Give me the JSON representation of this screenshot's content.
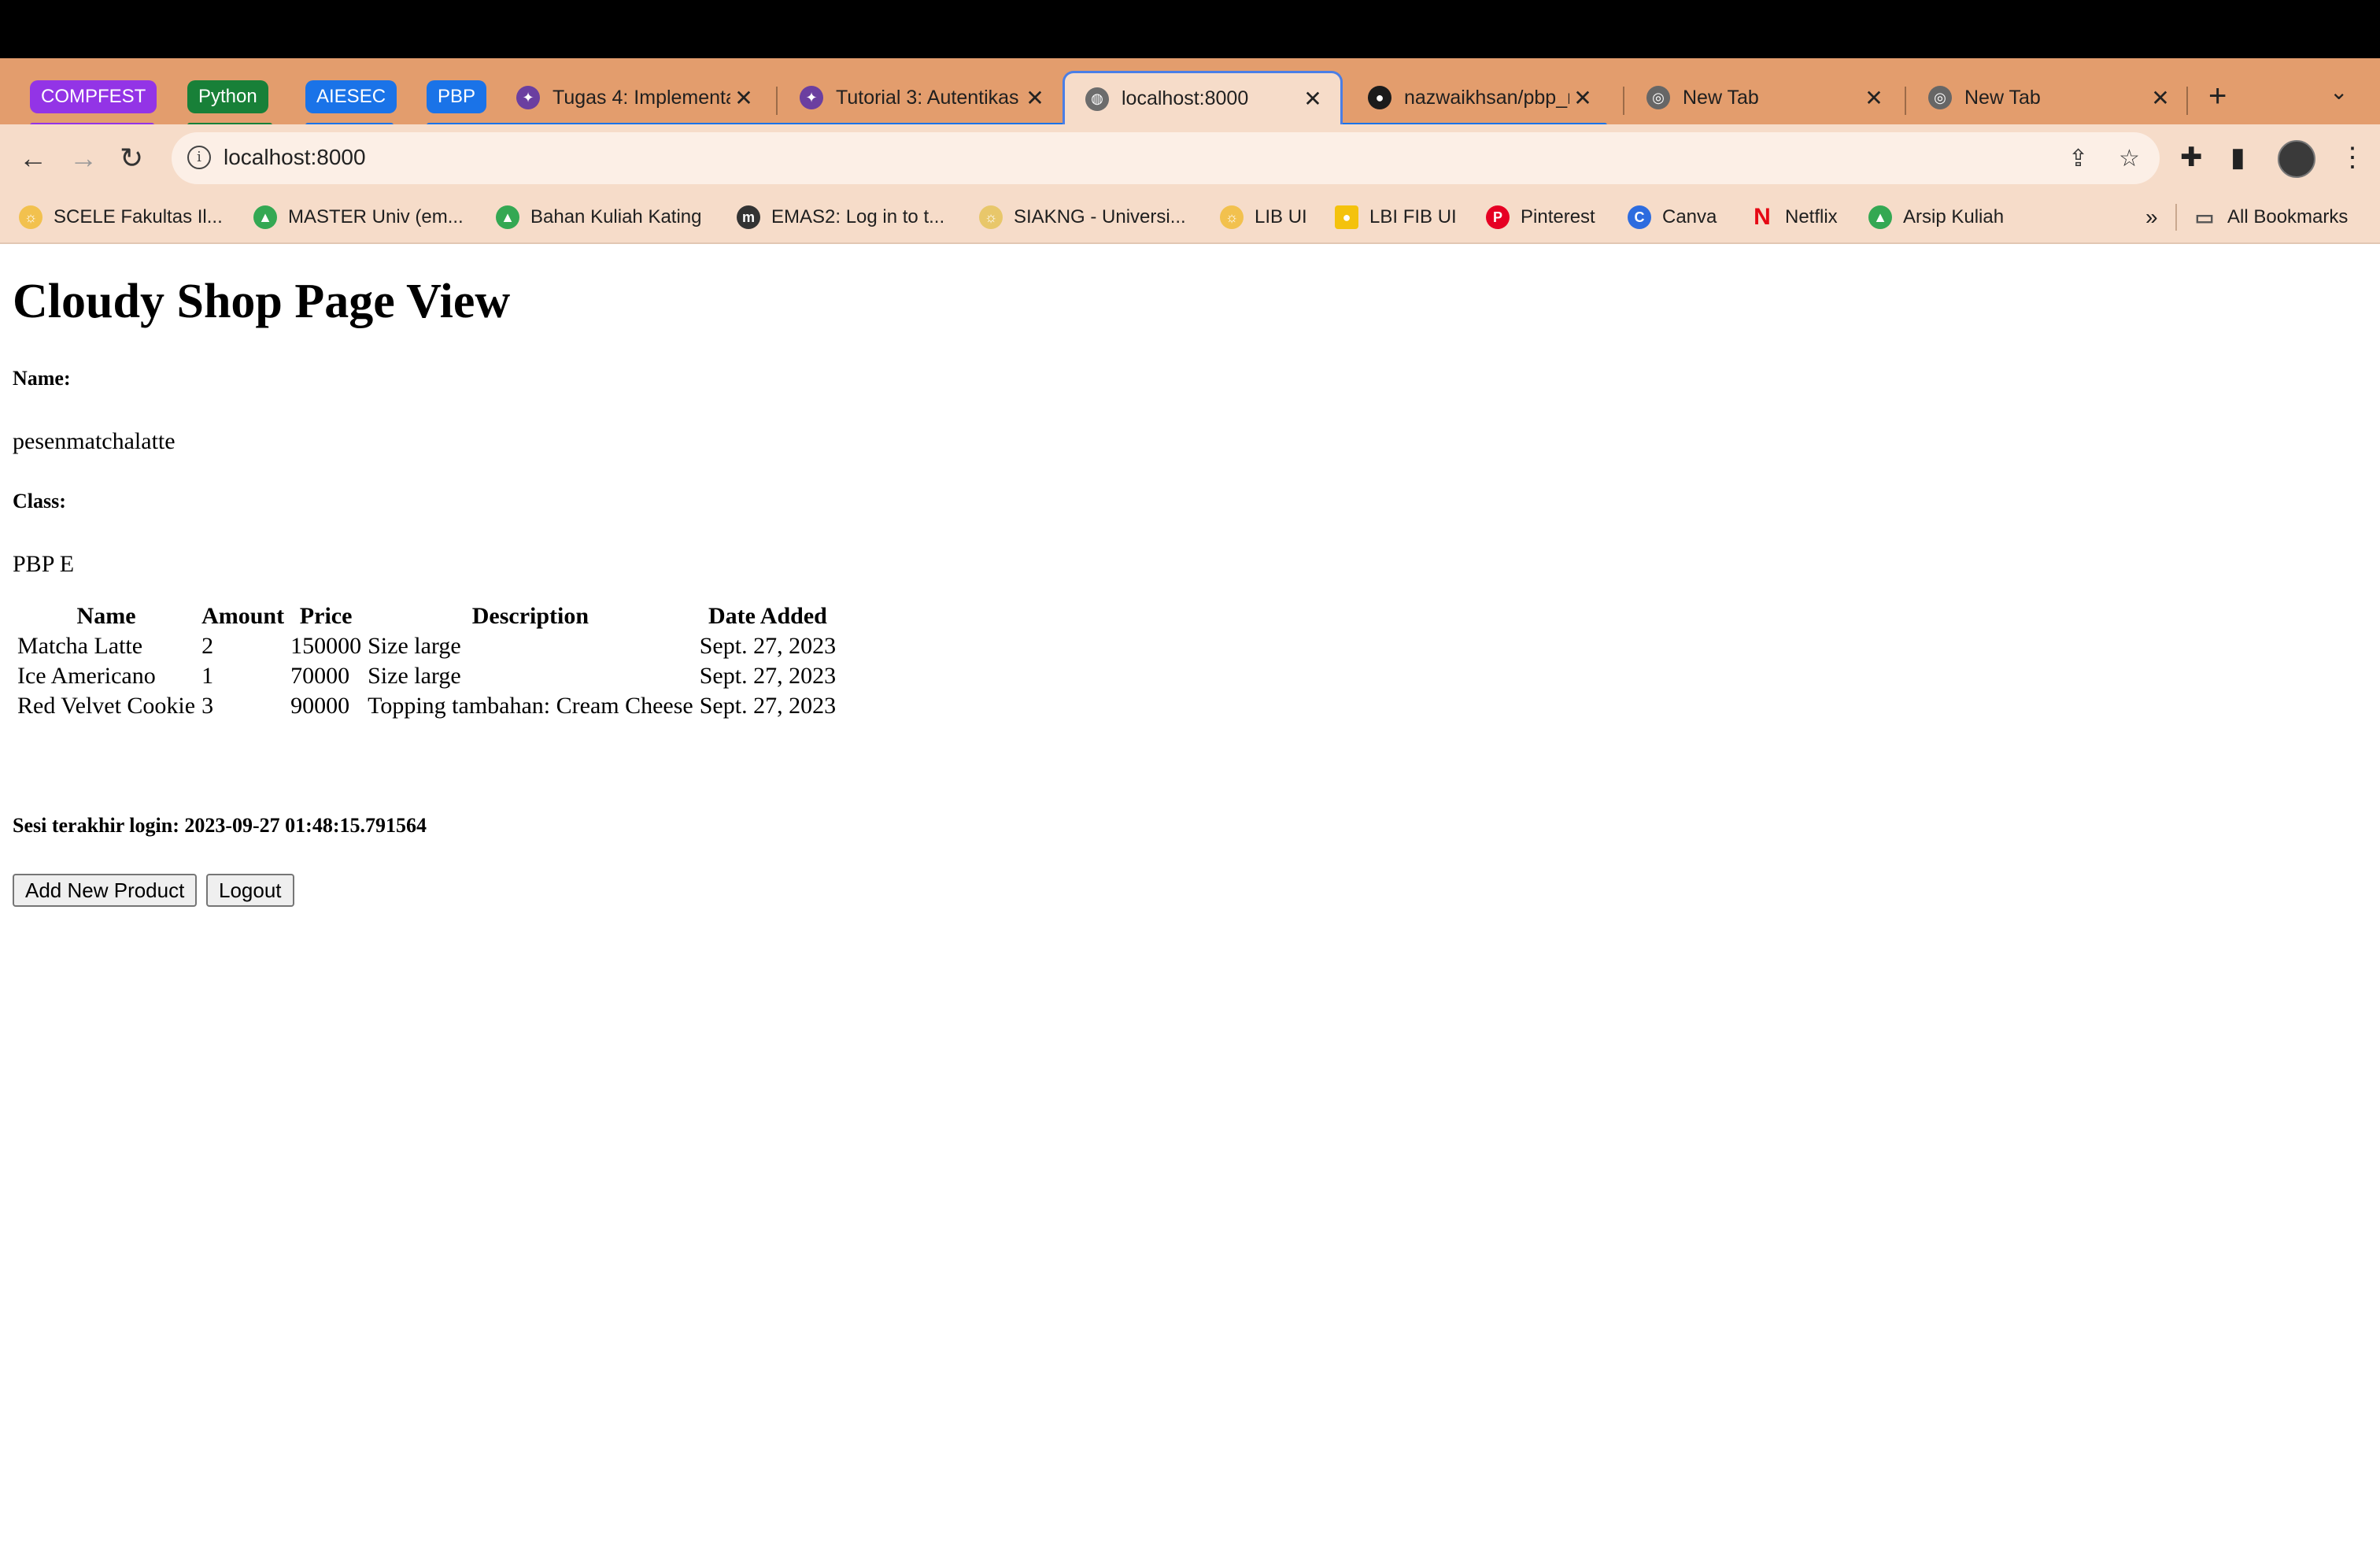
{
  "browser": {
    "tab_groups": [
      {
        "label": "COMPFEST",
        "color": "#9334e6"
      },
      {
        "label": "Python",
        "color": "#188038"
      },
      {
        "label": "AIESEC",
        "color": "#1a73e8"
      },
      {
        "label": "PBP",
        "color": "#1a73e8"
      }
    ],
    "tabs": [
      {
        "title": "Tugas 4: Implementa",
        "favicon": "pbp-logo-icon"
      },
      {
        "title": "Tutorial 3: Autentikas",
        "favicon": "pbp-logo-icon"
      },
      {
        "title": "localhost:8000",
        "favicon": "globe-icon",
        "active": true
      },
      {
        "title": "nazwaikhsan/pbp_na",
        "favicon": "github-icon"
      },
      {
        "title": "New Tab",
        "favicon": "chrome-icon"
      },
      {
        "title": "New Tab",
        "favicon": "chrome-icon"
      }
    ],
    "address": "localhost:8000",
    "bookmarks": [
      {
        "label": "SCELE Fakultas Il...",
        "icon": "scele-icon",
        "color": "#f2c14e"
      },
      {
        "label": "MASTER Univ (em...",
        "icon": "drive-icon",
        "color": "#34a853"
      },
      {
        "label": "Bahan Kuliah Kating",
        "icon": "drive-icon",
        "color": "#34a853"
      },
      {
        "label": "EMAS2: Log in to t...",
        "icon": "moodle-icon",
        "color": "#333333"
      },
      {
        "label": "SIAKNG - Universi...",
        "icon": "ui-seal-icon",
        "color": "#e8c76a"
      },
      {
        "label": "LIB UI",
        "icon": "ui-seal-icon",
        "color": "#f2c14e"
      },
      {
        "label": "LBI FIB UI",
        "icon": "lbi-icon",
        "color": "#f4c20d"
      },
      {
        "label": "Pinterest",
        "icon": "pinterest-icon",
        "color": "#e60023"
      },
      {
        "label": "Canva",
        "icon": "canva-icon",
        "color": "#2d6cdf"
      },
      {
        "label": "Netflix",
        "icon": "netflix-icon",
        "color": "#e50914"
      },
      {
        "label": "Arsip Kuliah",
        "icon": "drive-icon",
        "color": "#34a853"
      }
    ],
    "all_bookmarks": "All Bookmarks",
    "overflow": "»"
  },
  "page": {
    "title": "Cloudy Shop Page View",
    "name_label": "Name:",
    "name_value": "pesenmatchalatte",
    "class_label": "Class:",
    "class_value": "PBP E",
    "table": {
      "headers": [
        "Name",
        "Amount",
        "Price",
        "Description",
        "Date Added"
      ],
      "rows": [
        [
          "Matcha Latte",
          "2",
          "150000",
          "Size large",
          "Sept. 27, 2023"
        ],
        [
          "Ice Americano",
          "1",
          "70000",
          "Size large",
          "Sept. 27, 2023"
        ],
        [
          "Red Velvet Cookie",
          "3",
          "90000",
          "Topping tambahan: Cream Cheese",
          "Sept. 27, 2023"
        ]
      ]
    },
    "last_login": "Sesi terakhir login: 2023-09-27 01:48:15.791564",
    "add_button": "Add New Product",
    "logout_button": "Logout"
  }
}
